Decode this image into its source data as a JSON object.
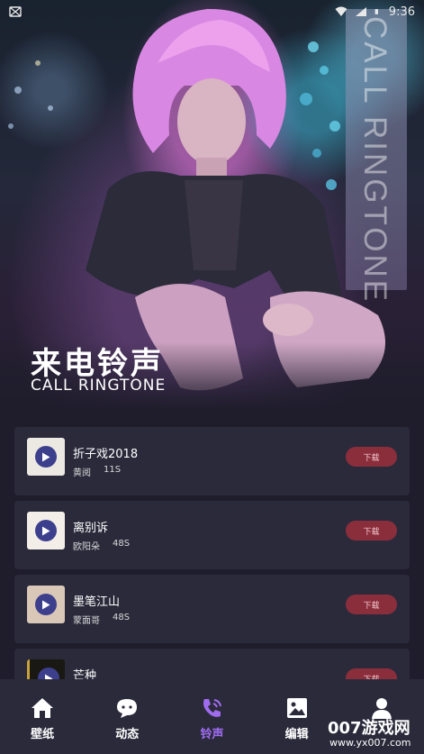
{
  "status_bar": {
    "time": "9:36"
  },
  "hero": {
    "title_cn": "来电铃声",
    "title_en": "CALL RINGTONE",
    "vertical_text": "CALL RINGTONE"
  },
  "ringtones": [
    {
      "title": "折子戏2018",
      "artist": "黄阅",
      "duration": "11S",
      "download_label": "下载"
    },
    {
      "title": "离别诉",
      "artist": "欧阳朵",
      "duration": "48S",
      "download_label": "下载"
    },
    {
      "title": "墨笔江山",
      "artist": "蒙面哥",
      "duration": "48S",
      "download_label": "下载"
    },
    {
      "title": "芒种",
      "artist": "",
      "duration": "",
      "download_label": "下载"
    }
  ],
  "nav": {
    "items": [
      {
        "label": "壁纸",
        "icon": "home-icon"
      },
      {
        "label": "动态",
        "icon": "chat-bubble-icon"
      },
      {
        "label": "铃声",
        "icon": "phone-ring-icon"
      },
      {
        "label": "编辑",
        "icon": "image-icon"
      },
      {
        "label": "",
        "icon": "profile-icon"
      }
    ],
    "active_index": 2,
    "active_color": "#9f6cf0"
  },
  "watermark": {
    "line1": "007游戏网",
    "line2": "www.yx007.com"
  }
}
